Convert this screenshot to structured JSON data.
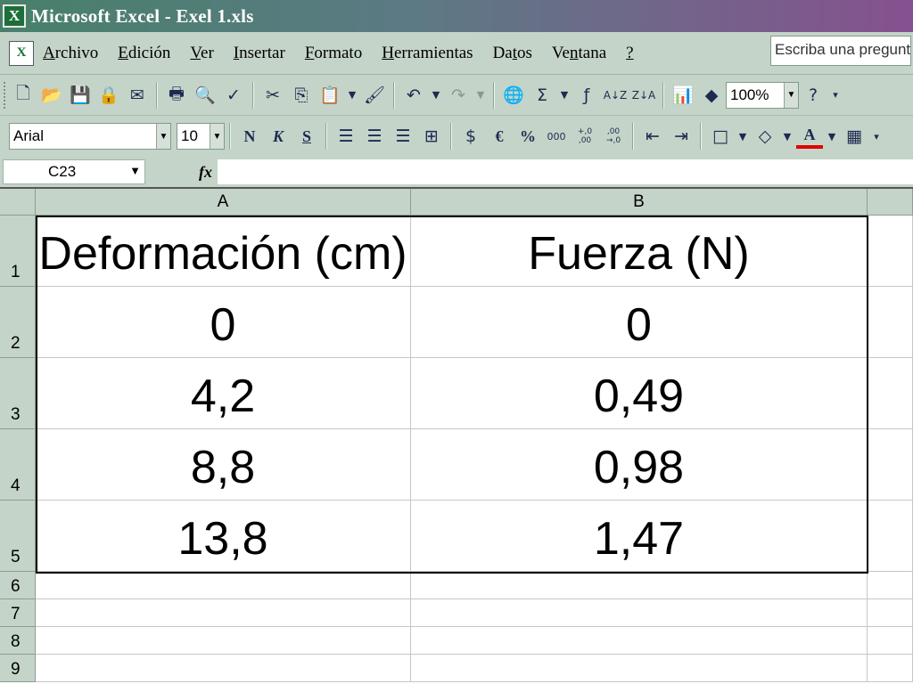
{
  "window": {
    "title": "Microsoft Excel - Exel 1.xls"
  },
  "menubar": {
    "items": [
      {
        "pre": "",
        "ul": "A",
        "post": "rchivo"
      },
      {
        "pre": "",
        "ul": "E",
        "post": "dición"
      },
      {
        "pre": "",
        "ul": "V",
        "post": "er"
      },
      {
        "pre": "",
        "ul": "I",
        "post": "nsertar"
      },
      {
        "pre": "",
        "ul": "F",
        "post": "ormato"
      },
      {
        "pre": "",
        "ul": "H",
        "post": "erramientas"
      },
      {
        "pre": "Da",
        "ul": "t",
        "post": "os"
      },
      {
        "pre": "Ve",
        "ul": "n",
        "post": "tana"
      },
      {
        "pre": "",
        "ul": "?",
        "post": ""
      }
    ],
    "ask_placeholder": "Escriba una pregunta"
  },
  "toolbar_standard": {
    "zoom": "100%",
    "icons": [
      "new-icon",
      "open-icon",
      "save-icon",
      "permission-icon",
      "email-icon",
      "print-icon",
      "print-preview-icon",
      "spelling-icon",
      "cut-icon",
      "copy-icon",
      "paste-icon",
      "format-painter-icon",
      "undo-icon",
      "redo-icon",
      "hyperlink-icon",
      "autosum-icon",
      "insert-function-icon",
      "sort-ascending-icon",
      "sort-descending-icon",
      "chart-wizard-icon",
      "drawing-icon",
      "help-icon"
    ],
    "sort_asc_label": "A↓Z",
    "sort_desc_label": "Z↓A"
  },
  "toolbar_format": {
    "font": "Arial",
    "size": "10",
    "bold": "N",
    "italic": "K",
    "underline": "S",
    "currency": "€",
    "percent": "%",
    "thousands": "000",
    "inc_decimal": "+,0 ,00",
    "dec_decimal": ",00 →,0"
  },
  "formula_bar": {
    "name_box": "C23",
    "fx_label": "fx",
    "formula": ""
  },
  "sheet": {
    "columns": [
      "A",
      "B"
    ],
    "rows": [
      {
        "num": "1",
        "a": "Deformación (cm)",
        "b": "Fuerza (N)"
      },
      {
        "num": "2",
        "a": "0",
        "b": "0"
      },
      {
        "num": "3",
        "a": "4,2",
        "b": "0,49"
      },
      {
        "num": "4",
        "a": "8,8",
        "b": "0,98"
      },
      {
        "num": "5",
        "a": "13,8",
        "b": "1,47"
      }
    ],
    "empty_rows": [
      "6",
      "7",
      "8",
      "9"
    ]
  }
}
